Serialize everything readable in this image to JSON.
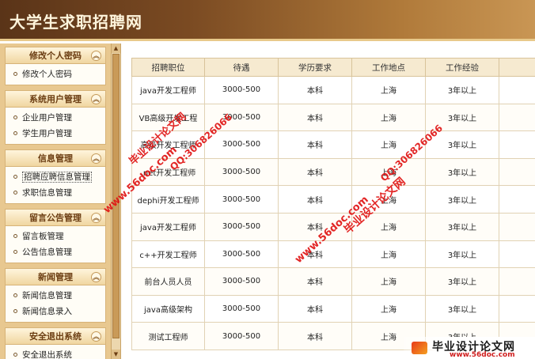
{
  "header": {
    "title": "大学生求职招聘网"
  },
  "sidebar": {
    "groups": [
      {
        "title": "修改个人密码",
        "items": [
          "修改个人密码"
        ]
      },
      {
        "title": "系统用户管理",
        "items": [
          "企业用户管理",
          "学生用户管理"
        ]
      },
      {
        "title": "信息管理",
        "items": [
          "招聘应聘信息管理",
          "求职信息管理"
        ]
      },
      {
        "title": "留言公告管理",
        "items": [
          "留言板管理",
          "公告信息管理"
        ]
      },
      {
        "title": "新闻管理",
        "items": [
          "新闻信息管理",
          "新闻信息录入"
        ]
      },
      {
        "title": "安全退出系统",
        "items": [
          "安全退出系统"
        ]
      }
    ]
  },
  "table": {
    "headers": [
      "招聘职位",
      "待遇",
      "学历要求",
      "工作地点",
      "工作经验"
    ],
    "rows": [
      [
        "java开发工程师",
        "3000-500",
        "本科",
        "上海",
        "3年以上"
      ],
      [
        "VB高级开发工程",
        "3000-500",
        "本科",
        "上海",
        "3年以上"
      ],
      [
        "高级开发工程师",
        "3000-500",
        "本科",
        "上海",
        "3年以上"
      ],
      [
        ".net开发工程师",
        "3000-500",
        "本科",
        "上海",
        "3年以上"
      ],
      [
        "dephi开发工程师",
        "3000-500",
        "本科",
        "上海",
        "3年以上"
      ],
      [
        "java开发工程师",
        "3000-500",
        "本科",
        "上海",
        "3年以上"
      ],
      [
        "c++开发工程师",
        "3000-500",
        "本科",
        "上海",
        "3年以上"
      ],
      [
        "前台人员人员",
        "3000-500",
        "本科",
        "上海",
        "3年以上"
      ],
      [
        "java高级架构",
        "3000-500",
        "本科",
        "上海",
        "3年以上"
      ],
      [
        "测试工程师",
        "3000-500",
        "本科",
        "上海",
        "3年以上"
      ]
    ]
  },
  "watermarks": {
    "site": "www.56doc.com",
    "qq": "QQ:306826066",
    "brand": "毕业设计论文网"
  },
  "logo": {
    "name": "毕业设计论文网",
    "url": "www.56doc.com"
  },
  "colors": {
    "header_dark": "#5a3418",
    "sidebar_bg": "#e8c890",
    "watermark": "#e01414"
  }
}
